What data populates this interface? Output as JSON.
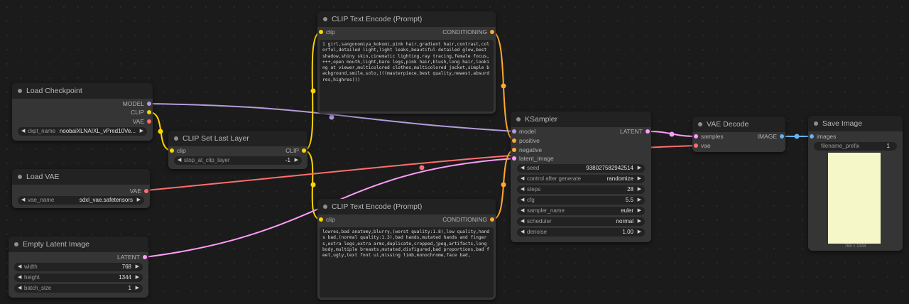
{
  "colors": {
    "clip": "#ffd500",
    "model": "#b39ddb",
    "vae": "#ff6e6e",
    "latent": "#ff9cf9",
    "conditioning": "#ffa931",
    "image": "#64b5f6",
    "background": "#1b1b1b",
    "node_body": "#353535",
    "node_title": "#222222"
  },
  "nodes": {
    "load_checkpoint": {
      "title": "Load Checkpoint",
      "outputs": [
        "MODEL",
        "CLIP",
        "VAE"
      ],
      "ckpt_name_label": "ckpt_name",
      "ckpt_name_value": "noobaiXLNAIXL_vPred10Ve..."
    },
    "clip_set_last_layer": {
      "title": "CLIP Set Last Layer",
      "input": "clip",
      "output": "CLIP",
      "stop_label": "stop_at_clip_layer",
      "stop_value": "-1"
    },
    "load_vae": {
      "title": "Load VAE",
      "output": "VAE",
      "vae_name_label": "vae_name",
      "vae_name_value": "sdxl_vae.safetensors"
    },
    "empty_latent": {
      "title": "Empty Latent Image",
      "output": "LATENT",
      "width_label": "width",
      "width_value": "768",
      "height_label": "height",
      "height_value": "1344",
      "batch_label": "batch_size",
      "batch_value": "1"
    },
    "clip_pos": {
      "title": "CLIP Text Encode (Prompt)",
      "input": "clip",
      "output": "CONDITIONING",
      "text": "1 girl,sangonomiya_kokomi,pink hair,gradient hair,contrast,colorful,detailed light,light leaks,beautiful detailed glow,best shadow,shiny skin,cinematic lighting,ray tracing,female focus,+++,open mouth,light,bare legs,pink hair,blush,long hair,looking at viewer,multicolored clothes,multicolored jacket,simple background,smile,solo,(((masterpiece,best quality,newest,absurdres,highres)))"
    },
    "clip_neg": {
      "title": "CLIP Text Encode (Prompt)",
      "input": "clip",
      "output": "CONDITIONING",
      "text": "lowres,bad anatomy,blurry,(worst quality:1.8),low quality,hands bad,(normal quality:1.3),bad hands,mutated hands and fingers,extra legs,extra arms,duplicate,cropped,jpeg,artifacts,long body,multiple breasts,mutated,disfigured,bad proportions,bad feet,ugly,text font ui,missing limb,monochrome,face bad,"
    },
    "ksampler": {
      "title": "KSampler",
      "inputs": [
        "model",
        "positive",
        "negative",
        "latent_image"
      ],
      "output": "LATENT",
      "widgets": [
        {
          "label": "seed",
          "value": "938027582942514"
        },
        {
          "label": "control after generate",
          "value": "randomize"
        },
        {
          "label": "steps",
          "value": "28"
        },
        {
          "label": "cfg",
          "value": "5.5"
        },
        {
          "label": "sampler_name",
          "value": "euler"
        },
        {
          "label": "scheduler",
          "value": "normal"
        },
        {
          "label": "denoise",
          "value": "1.00"
        }
      ]
    },
    "vae_decode": {
      "title": "VAE Decode",
      "inputs": [
        "samples",
        "vae"
      ],
      "output": "IMAGE"
    },
    "save_image": {
      "title": "Save Image",
      "input": "images",
      "prefix_label": "filename_prefix",
      "prefix_value": "1",
      "preview_caption": "768 × 1344"
    }
  },
  "glyphs": {
    "left_arrow": "◀",
    "right_arrow": "▶"
  }
}
